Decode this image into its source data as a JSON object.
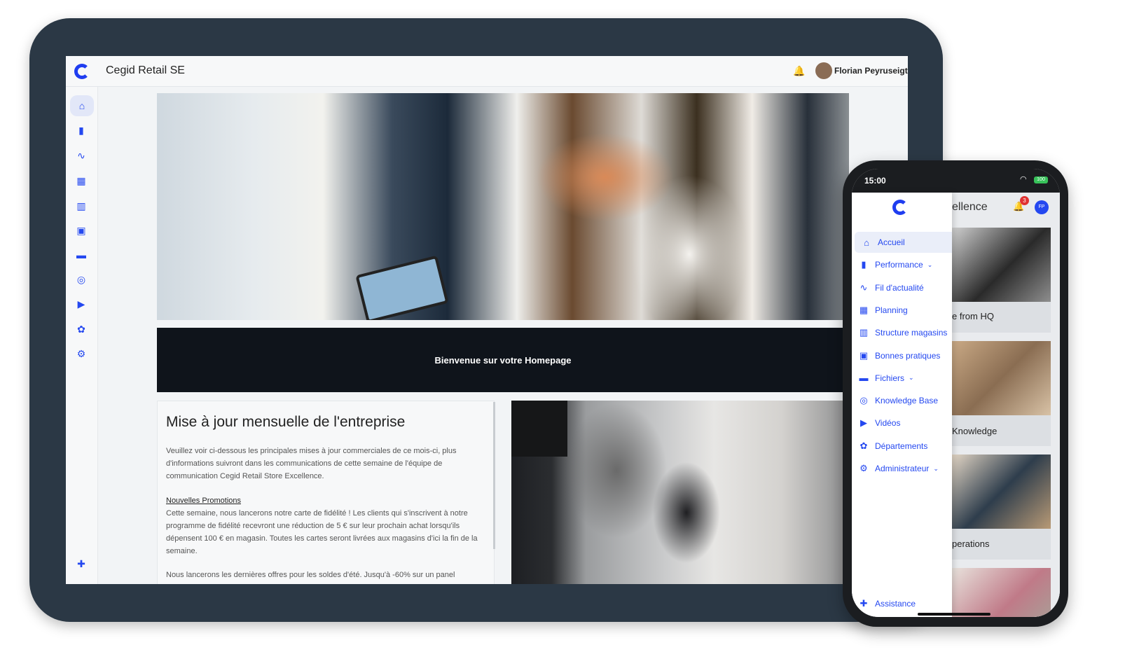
{
  "tablet": {
    "app_title": "Cegid Retail SE",
    "user_name": "Florian Peyruseigt",
    "sidebar_icons": [
      "home-icon",
      "bar-chart-icon",
      "activity-icon",
      "calendar-icon",
      "map-icon",
      "image-icon",
      "folder-icon",
      "knowledge-icon",
      "video-icon",
      "departments-icon",
      "admin-icon",
      "help-icon"
    ],
    "welcome_text": "Bienvenue sur votre Homepage",
    "card": {
      "title": "Mise à jour mensuelle de l'entreprise",
      "intro": "Veuillez voir ci-dessous les principales mises à jour commerciales de ce mois-ci, plus d'informations suivront dans les communications de cette semaine de l'équipe de communication Cegid Retail Store Excellence.",
      "section_title": "Nouvelles Promotions",
      "section_body": "Cette semaine, nous lancerons notre carte de fidélité ! Les clients qui s'inscrivent à notre programme de fidélité recevront une réduction de 5 € sur leur prochain achat lorsqu'ils dépensent 100 € en magasin. Toutes les cartes seront livrées aux magasins d'ici la fin de la semaine.",
      "next_paragraph": "Nous lancerons les dernières offres pour les soldes d'été. Jusqu'à -60% sur un panel"
    }
  },
  "phone": {
    "time": "15:00",
    "battery": "100",
    "menu_items": [
      {
        "label": "Accueil",
        "icon": "home-icon",
        "active": true,
        "chevron": false
      },
      {
        "label": "Performance",
        "icon": "bar-chart-icon",
        "active": false,
        "chevron": true
      },
      {
        "label": "Fil d'actualité",
        "icon": "activity-icon",
        "active": false,
        "chevron": false
      },
      {
        "label": "Planning",
        "icon": "calendar-icon",
        "active": false,
        "chevron": false
      },
      {
        "label": "Structure magasins",
        "icon": "map-icon",
        "active": false,
        "chevron": false
      },
      {
        "label": "Bonnes pratiques",
        "icon": "image-icon",
        "active": false,
        "chevron": false
      },
      {
        "label": "Fichiers",
        "icon": "folder-icon",
        "active": false,
        "chevron": true
      },
      {
        "label": "Knowledge Base",
        "icon": "knowledge-icon",
        "active": false,
        "chevron": false
      },
      {
        "label": "Vidéos",
        "icon": "video-icon",
        "active": false,
        "chevron": false
      },
      {
        "label": "Départements",
        "icon": "departments-icon",
        "active": false,
        "chevron": false
      },
      {
        "label": "Administrateur",
        "icon": "admin-icon",
        "active": false,
        "chevron": true
      }
    ],
    "assistance_label": "Assistance",
    "behind": {
      "title_fragment": "ellence",
      "notification_count": "3",
      "avatar_initials": "FP",
      "tile_labels": [
        "e from HQ",
        "Knowledge",
        "perations"
      ]
    }
  }
}
